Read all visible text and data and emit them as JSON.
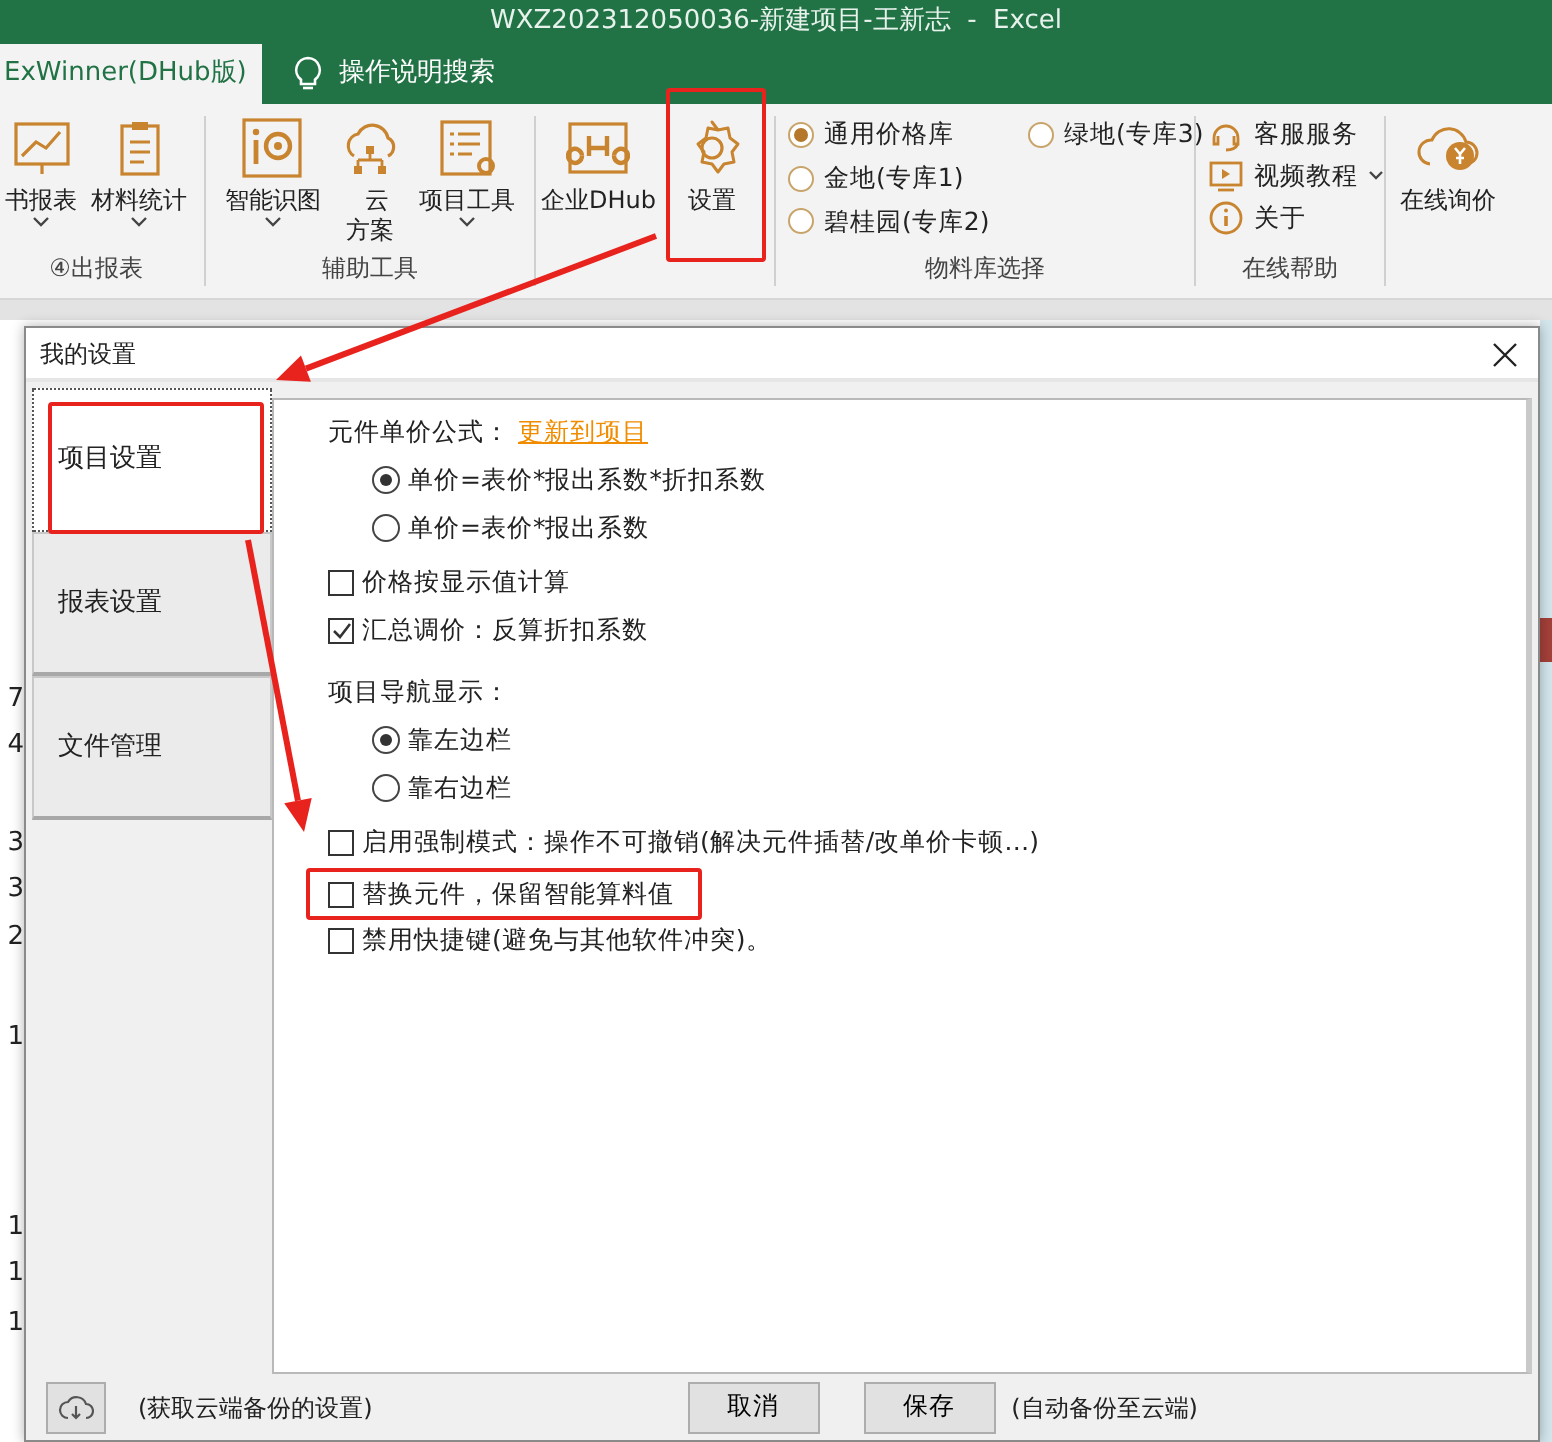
{
  "window": {
    "title": "WXZ202312050036-新建项目-王新志  -  Excel"
  },
  "ribbon_tabs": [
    {
      "label": "ExWinner(DHub版)",
      "selected": true
    }
  ],
  "tell_me": {
    "label": "操作说明搜索"
  },
  "ribbon_groups": [
    {
      "label": "④出报表",
      "buttons": [
        {
          "label": "书报表",
          "dropdown": true
        },
        {
          "label": "材料统计",
          "dropdown": true
        }
      ]
    },
    {
      "label": "辅助工具",
      "buttons": [
        {
          "label": "智能识图",
          "dropdown": true
        },
        {
          "label": "云方案",
          "dropdown": false
        },
        {
          "label": "项目工具",
          "dropdown": true
        }
      ]
    },
    {
      "buttons": [
        {
          "label": "企业DHub",
          "dropdown": false
        },
        {
          "label": "设置",
          "dropdown": false
        }
      ]
    }
  ],
  "library_group": {
    "label": "物料库选择",
    "options": [
      {
        "label": "通用价格库",
        "selected": true
      },
      {
        "label": "绿地(专库3)",
        "selected": false
      },
      {
        "label": "金地(专库1)",
        "selected": false
      },
      {
        "label": "碧桂园(专库2)",
        "selected": false
      }
    ]
  },
  "help_group": {
    "label": "在线帮助",
    "items": [
      {
        "label": "客服服务",
        "dropdown": false
      },
      {
        "label": "视频教程",
        "dropdown": true
      },
      {
        "label": "关于",
        "dropdown": false
      }
    ]
  },
  "inquiry_button": {
    "label": "在线询价"
  },
  "sheet_fragments": [
    "7",
    "4",
    "3",
    "3",
    "2",
    "1",
    "1",
    "1",
    "1"
  ],
  "dialog": {
    "title": "我的设置",
    "tabs": [
      {
        "label": "项目设置",
        "selected": true
      },
      {
        "label": "报表设置",
        "selected": false
      },
      {
        "label": "文件管理",
        "selected": false
      }
    ],
    "settings": [
      {
        "kind": "label",
        "text": "元件单价公式：",
        "link": "更新到项目",
        "highlighted": false
      },
      {
        "kind": "radio",
        "text": "单价=表价*报出系数*折扣系数",
        "selected": true,
        "highlighted": false
      },
      {
        "kind": "radio",
        "text": "单价=表价*报出系数",
        "selected": false,
        "highlighted": false
      },
      {
        "kind": "checkbox",
        "text": "价格按显示值计算",
        "checked": false,
        "highlighted": false
      },
      {
        "kind": "checkbox",
        "text": "汇总调价：反算折扣系数",
        "checked": true,
        "highlighted": false
      },
      {
        "kind": "label",
        "text": "项目导航显示：",
        "highlighted": false
      },
      {
        "kind": "radio",
        "text": "靠左边栏",
        "selected": true,
        "highlighted": false
      },
      {
        "kind": "radio",
        "text": "靠右边栏",
        "selected": false,
        "highlighted": false
      },
      {
        "kind": "checkbox",
        "text": "启用强制模式：操作不可撤销(解决元件插替/改单价卡顿…)",
        "checked": false,
        "highlighted": false
      },
      {
        "kind": "checkbox",
        "text": "替换元件，保留智能算料值",
        "checked": false,
        "highlighted": true
      },
      {
        "kind": "checkbox",
        "text": "禁用快捷键(避免与其他软件冲突)。",
        "checked": false,
        "highlighted": false
      }
    ],
    "footer": {
      "cloud_note": "(获取云端备份的设置)",
      "buttons": [
        "取消",
        "保存"
      ],
      "save_note": "(自动备份至云端)"
    }
  }
}
